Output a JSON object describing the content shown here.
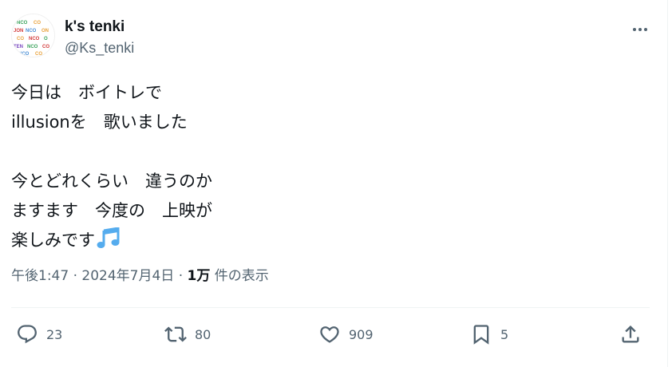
{
  "user": {
    "display_name": "k's tenki",
    "handle": "@Ks_tenki",
    "avatar_icon": "colorful-pattern-avatar"
  },
  "post": {
    "lines": [
      "今日は　ボイトレで",
      "illusionを　歌いました",
      "",
      "今とどれくらい　違うのか",
      "ますます　今度の　上映が",
      "楽しみです"
    ],
    "trailing_emoji": "musical-notes-icon"
  },
  "meta": {
    "time": "午後1:47",
    "separator1": "·",
    "date": "2024年7月4日",
    "separator2": "·",
    "views_count": "1万",
    "views_label": "件の表示"
  },
  "actions": {
    "reply_count": "23",
    "repost_count": "80",
    "like_count": "909",
    "bookmark_count": "5"
  },
  "colors": {
    "text": "#0f1419",
    "secondary": "#536471",
    "border": "#eff3f4",
    "note_blue": "#55acee"
  }
}
